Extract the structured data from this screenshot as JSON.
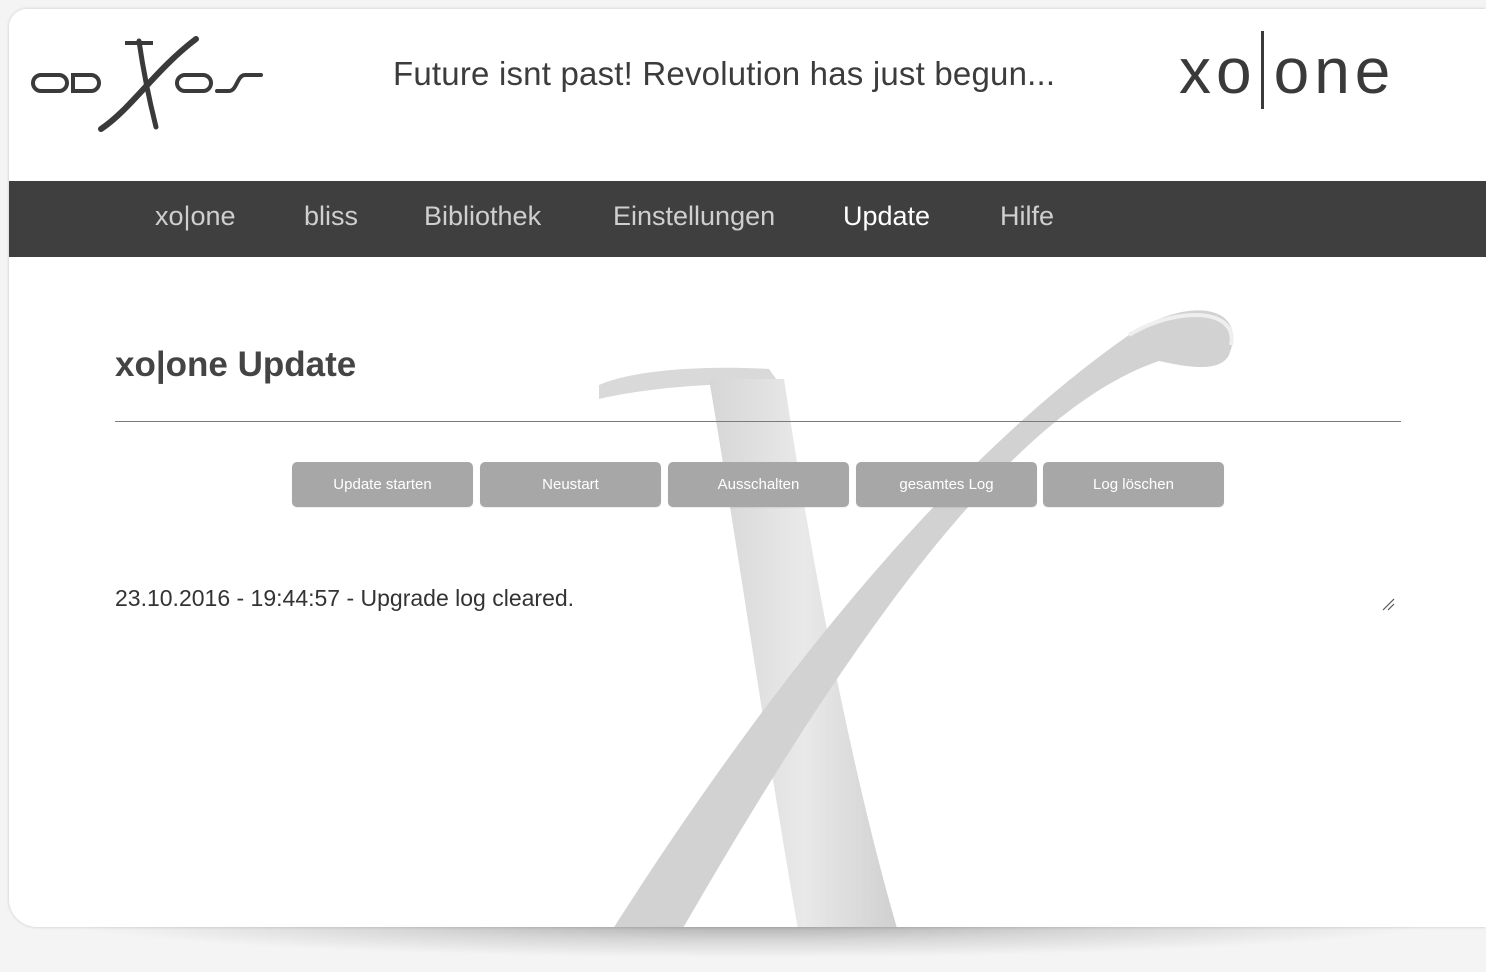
{
  "header": {
    "logo_name": "odXos logo",
    "tagline": "Future isnt past! Revolution has just begun...",
    "brand_left": "xo",
    "brand_right": "one"
  },
  "nav": {
    "items": [
      {
        "label": "xo|one"
      },
      {
        "label": "bliss"
      },
      {
        "label": "Bibliothek"
      },
      {
        "label": "Einstellungen"
      },
      {
        "label": "Update"
      },
      {
        "label": "Hilfe"
      }
    ],
    "active": "Update"
  },
  "main": {
    "title": "xo|one Update",
    "buttons": [
      {
        "label": "Update starten"
      },
      {
        "label": "Neustart"
      },
      {
        "label": "Ausschalten"
      },
      {
        "label": "gesamtes Log"
      },
      {
        "label": "Log löschen"
      }
    ],
    "log": "23.10.2016 - 19:44:57 - Upgrade log cleared."
  },
  "colors": {
    "nav_bg": "#3f3f3f",
    "button_bg": "#a7a7a7",
    "text": "#444444"
  }
}
